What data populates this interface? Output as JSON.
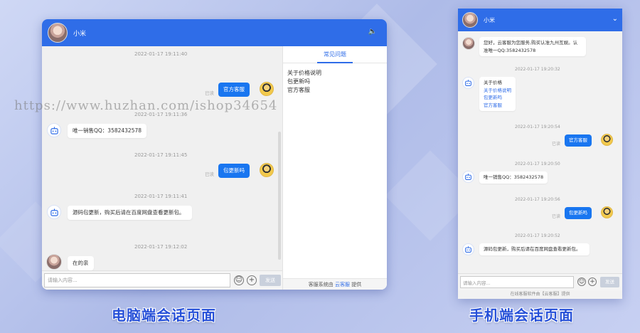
{
  "colors": {
    "primary": "#2f6de8",
    "bubble_out": "#1976f0"
  },
  "desktop": {
    "contact_name": "小米",
    "speaker_icon": "speaker-icon",
    "messages": [
      {
        "time": "2022-01-17 19:11:40",
        "text": "官方客服",
        "read": "已读"
      },
      {
        "time": "2022-01-17 19:11:36",
        "text": "唯一销售QQ：3582432578"
      },
      {
        "time": "2022-01-17 19:11:45",
        "text": "包更新吗",
        "read": "已读"
      },
      {
        "time": "2022-01-17 19:11:41",
        "text": "源码包更新，购买后请在百度网盘查看更新包。"
      },
      {
        "time": "2022-01-17 19:12:02",
        "text": "在的亲"
      }
    ],
    "input_placeholder": "请输入内容...",
    "send_label": "发送",
    "side_tab": "常见问题",
    "faq": [
      "关于价格说明",
      "包更新吗",
      "官方客服"
    ],
    "footer_prefix": "客服系统由",
    "footer_brand": "云客服",
    "footer_suffix": "提供"
  },
  "mobile": {
    "contact_name": "小米",
    "messages": [
      {
        "text": "您好，云客服为您服务,购买认准九州互娱。认准唯一QQ:3582432578"
      },
      {
        "time": "2022-01-17 19:20:32",
        "title": "关于价格",
        "links": [
          "关于价格说明",
          "包更新吗",
          "官方客服"
        ]
      },
      {
        "time": "2022-01-17 19:20:54",
        "text": "官方客服",
        "read": "已读"
      },
      {
        "time": "2022-01-17 19:20:50",
        "text": "唯一销售QQ：3582432578"
      },
      {
        "time": "2022-01-17 19:20:56",
        "text": "包更新吗",
        "read": "已读"
      },
      {
        "time": "2022-01-17 19:20:52",
        "text": "源码包更新，购买后请在百度网盘查看更新包。"
      }
    ],
    "input_placeholder": "请输入内容...",
    "send_label": "发送",
    "footer": "在线客服软件由【云客服】提供"
  },
  "captions": {
    "desktop": "电脑端会话页面",
    "mobile": "手机端会话页面"
  },
  "watermark": "https://www.huzhan.com/ishop34654"
}
